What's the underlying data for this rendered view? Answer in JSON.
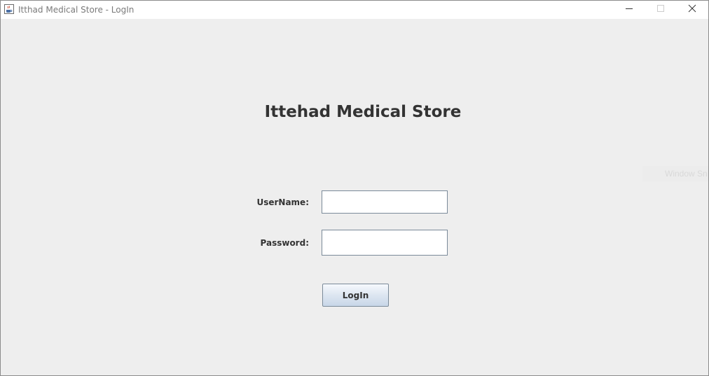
{
  "window": {
    "title": "Itthad Medical Store - LogIn",
    "icon": "java-coffee-cup-icon",
    "controls": {
      "minimize_icon": "minimize-icon",
      "maximize_icon": "maximize-icon",
      "close_icon": "close-icon"
    }
  },
  "login": {
    "heading": "Ittehad Medical Store",
    "username_label": "UserName:",
    "username_value": "",
    "password_label": "Password:",
    "password_value": "",
    "login_button": "LogIn"
  },
  "background_hint": {
    "text": "Window Sn"
  },
  "colors": {
    "background": "#eeeeee",
    "titlebar": "#ffffff",
    "text": "#333333",
    "button_top": "#f6f9fd",
    "button_bottom": "#c8d7e8"
  }
}
